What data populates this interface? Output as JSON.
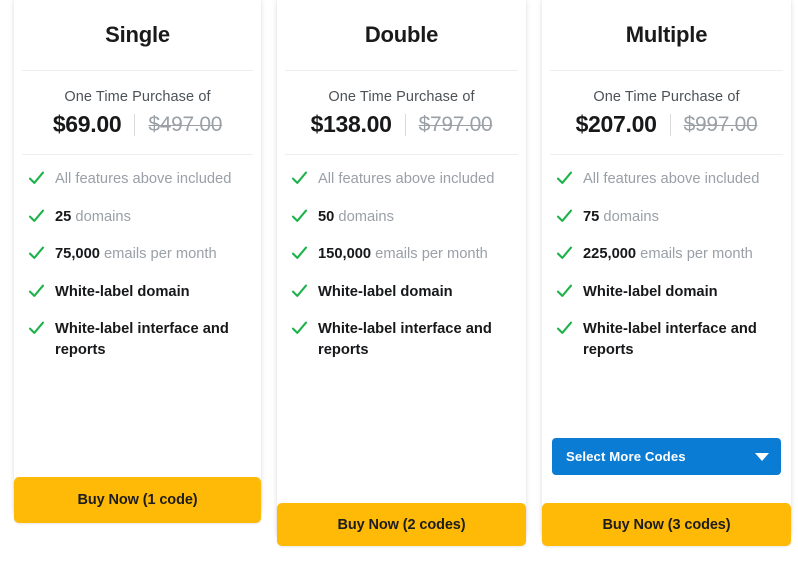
{
  "plans": [
    {
      "title": "Single",
      "price_caption": "One Time Purchase of",
      "price_now": "$69.00",
      "price_was": "$497.00",
      "features": [
        {
          "highlight": "",
          "rest": "All features above included",
          "bold_all": false
        },
        {
          "highlight": "25",
          "rest": " domains",
          "bold_all": false
        },
        {
          "highlight": "75,000",
          "rest": " emails per month",
          "bold_all": false
        },
        {
          "highlight": "",
          "rest": "White-label domain",
          "bold_all": true
        },
        {
          "highlight": "",
          "rest": "White-label interface and reports",
          "bold_all": true
        }
      ],
      "has_select": false,
      "select_label": "",
      "buy_label": "Buy Now (1 code)"
    },
    {
      "title": "Double",
      "price_caption": "One Time Purchase of",
      "price_now": "$138.00",
      "price_was": "$797.00",
      "features": [
        {
          "highlight": "",
          "rest": "All features above included",
          "bold_all": false
        },
        {
          "highlight": "50",
          "rest": " domains",
          "bold_all": false
        },
        {
          "highlight": "150,000",
          "rest": " emails per month",
          "bold_all": false
        },
        {
          "highlight": "",
          "rest": "White-label domain",
          "bold_all": true
        },
        {
          "highlight": "",
          "rest": "White-label interface and reports",
          "bold_all": true
        }
      ],
      "has_select": false,
      "select_label": "",
      "buy_label": "Buy Now (2 codes)"
    },
    {
      "title": "Multiple",
      "price_caption": "One Time Purchase of",
      "price_now": "$207.00",
      "price_was": "$997.00",
      "features": [
        {
          "highlight": "",
          "rest": "All features above included",
          "bold_all": false
        },
        {
          "highlight": "75",
          "rest": " domains",
          "bold_all": false
        },
        {
          "highlight": "225,000",
          "rest": " emails per month",
          "bold_all": false
        },
        {
          "highlight": "",
          "rest": "White-label domain",
          "bold_all": true
        },
        {
          "highlight": "",
          "rest": "White-label interface and reports",
          "bold_all": true
        }
      ],
      "has_select": true,
      "select_label": "Select More Codes",
      "buy_label": "Buy Now (3 codes)"
    }
  ],
  "icons": {
    "check": "check-icon",
    "caret": "chevron-down-icon"
  },
  "colors": {
    "check_green": "#1eb24b",
    "buy_yellow": "#ffb907",
    "select_blue": "#0b7cd4",
    "muted_text": "#9aa0a6",
    "strong_text": "#17181a"
  }
}
